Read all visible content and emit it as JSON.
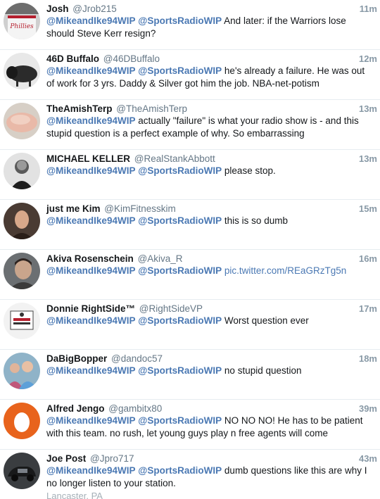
{
  "tweets": [
    {
      "name": "Josh",
      "handle": "@Jrob215",
      "time": "11m",
      "mentions": [
        "@MikeandIke94WIP",
        "@SportsRadioWIP"
      ],
      "text": "And later: if the Warriors lose should Steve Kerr resign?",
      "avatar_icon": "phillies-jersey-avatar"
    },
    {
      "name": "46D Buffalo",
      "handle": "@46DBuffalo",
      "time": "12m",
      "mentions": [
        "@MikeandIke94WIP",
        "@SportsRadioWIP"
      ],
      "text": "he's already a failure. He was out of work for 3 yrs. Daddy & Silver got him the job.  NBA-net-potism",
      "avatar_icon": "buffalo-avatar"
    },
    {
      "name": "TheAmishTerp",
      "handle": "@TheAmishTerp",
      "time": "13m",
      "mentions": [
        "@MikeandIke94WIP"
      ],
      "text": "actually \"failure\" is what your radio show is - and this stupid question is a perfect example of why. So embarrassing",
      "avatar_icon": "bread-avatar"
    },
    {
      "name": "MICHAEL KELLER",
      "handle": "@RealStankAbbott",
      "time": "13m",
      "mentions": [
        "@MikeandIke94WIP",
        "@SportsRadioWIP"
      ],
      "text": "please stop.",
      "avatar_icon": "singer-avatar"
    },
    {
      "name": "just me Kim",
      "handle": "@KimFitnesskim",
      "time": "15m",
      "mentions": [
        "@MikeandIke94WIP",
        "@SportsRadioWIP"
      ],
      "text": "this is so dumb",
      "avatar_icon": "woman-portrait-avatar"
    },
    {
      "name": "Akiva Rosenschein",
      "handle": "@Akiva_R",
      "time": "16m",
      "mentions": [
        "@MikeandIke94WIP",
        "@SportsRadioWIP"
      ],
      "text": "",
      "link": "pic.twitter.com/REaGRzTg5n",
      "avatar_icon": "man-portrait-avatar"
    },
    {
      "name": "Donnie RightSide™",
      "handle": "@RightSideVP",
      "time": "17m",
      "mentions": [
        "@MikeandIke94WIP",
        "@SportsRadioWIP"
      ],
      "text": "Worst question ever",
      "avatar_icon": "logo-avatar"
    },
    {
      "name": "DaBigBopper",
      "handle": "@dandoc57",
      "time": "18m",
      "mentions": [
        "@MikeandIke94WIP",
        "@SportsRadioWIP"
      ],
      "text": "no stupid question",
      "avatar_icon": "family-avatar"
    },
    {
      "name": "Alfred Jengo",
      "handle": "@gambitx80",
      "time": "39m",
      "mentions": [
        "@MikeandIke94WIP",
        "@SportsRadioWIP"
      ],
      "text": "NO NO NO! He has to be patient with this team. no rush, let young guys play n free agents will come",
      "avatar_icon": "default-egg-avatar"
    },
    {
      "name": "Joe Post",
      "handle": "@Jpro717",
      "time": "43m",
      "mentions": [
        "@MikeandIke94WIP",
        "@SportsRadioWIP"
      ],
      "text": "dumb questions like this are why I no longer listen to your station.",
      "location": "Lancaster, PA",
      "avatar_icon": "car-avatar"
    }
  ],
  "colors": {
    "mention": "#4a78b3",
    "time": "#8899a6",
    "handle": "#657786",
    "divider": "#e6ecf0",
    "egg_orange": "#e8631c"
  }
}
